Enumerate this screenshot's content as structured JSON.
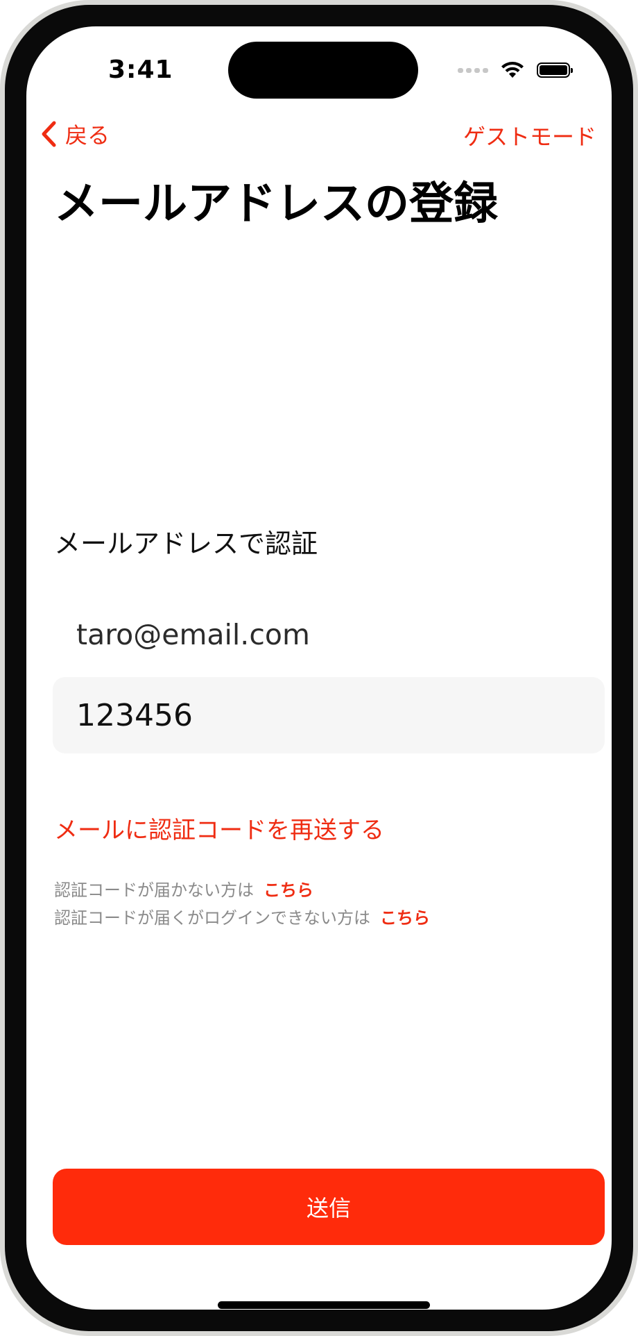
{
  "status_bar": {
    "time": "3:41",
    "icons": [
      "signal-icon",
      "wifi-icon",
      "battery-icon"
    ]
  },
  "nav": {
    "back_label": "戻る",
    "guest_mode_label": "ゲストモード"
  },
  "page": {
    "title": "メールアドレスの登録"
  },
  "form": {
    "section_label": "メールアドレスで認証",
    "email_value": "taro@email.com",
    "code_value": "123456",
    "resend_link": "メールに認証コードを再送する"
  },
  "help": {
    "line1_text": "認証コードが届かない方は",
    "line1_link": "こちら",
    "line2_text": "認証コードが届くがログインできない方は",
    "line2_link": "こちら"
  },
  "submit": {
    "label": "送信"
  },
  "colors": {
    "accent": "#ef2c12",
    "button": "#ff2b0b",
    "input_bg": "#f6f6f6"
  }
}
